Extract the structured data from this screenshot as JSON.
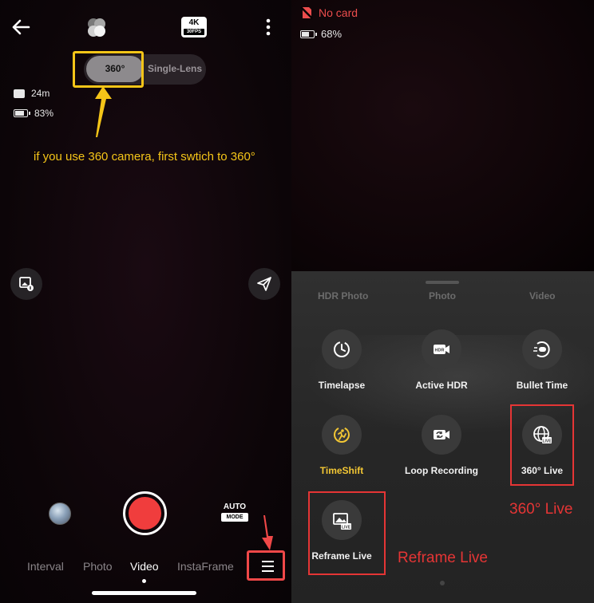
{
  "left_screen": {
    "mode_toggle": {
      "option_360": "360°",
      "option_single": "Single-Lens"
    },
    "resolution_badge": {
      "res": "4K",
      "fps": "30FPS"
    },
    "storage_remaining": "24m",
    "battery": "83%",
    "battery_level": 0.83,
    "annotation": "if you use 360 camera, first swtich to 360°",
    "auto_mode": {
      "top": "AUTO",
      "bottom": "MODE"
    },
    "tabs": [
      "Interval",
      "Photo",
      "Video",
      "InstaFrame"
    ],
    "active_tab": "Video",
    "icons": [
      "back-arrow-icon",
      "lens-icon",
      "more-icon",
      "gallery-icon",
      "send-icon",
      "menu-icon"
    ]
  },
  "right_screen": {
    "card_status": "No card",
    "battery": "68%",
    "battery_level": 0.68,
    "categories": [
      "HDR Photo",
      "Photo",
      "Video"
    ],
    "modes": [
      {
        "label": "Timelapse",
        "icon": "timelapse-icon"
      },
      {
        "label": "Active HDR",
        "icon": "hdr-icon"
      },
      {
        "label": "Bullet Time",
        "icon": "bullet-time-icon"
      },
      {
        "label": "TimeShift",
        "icon": "timeshift-icon"
      },
      {
        "label": "Loop Recording",
        "icon": "loop-recording-icon"
      },
      {
        "label": "360° Live",
        "icon": "globe-live-icon"
      },
      {
        "label": "Reframe Live",
        "icon": "reframe-live-icon"
      }
    ],
    "annotations": {
      "live_360": "360° Live",
      "reframe_live": "Reframe Live"
    }
  },
  "colors": {
    "highlight_yellow": "#f5c518",
    "highlight_red": "#e53535",
    "shutter_red": "#f03d3d",
    "timeshift_gold": "#f3c734"
  }
}
